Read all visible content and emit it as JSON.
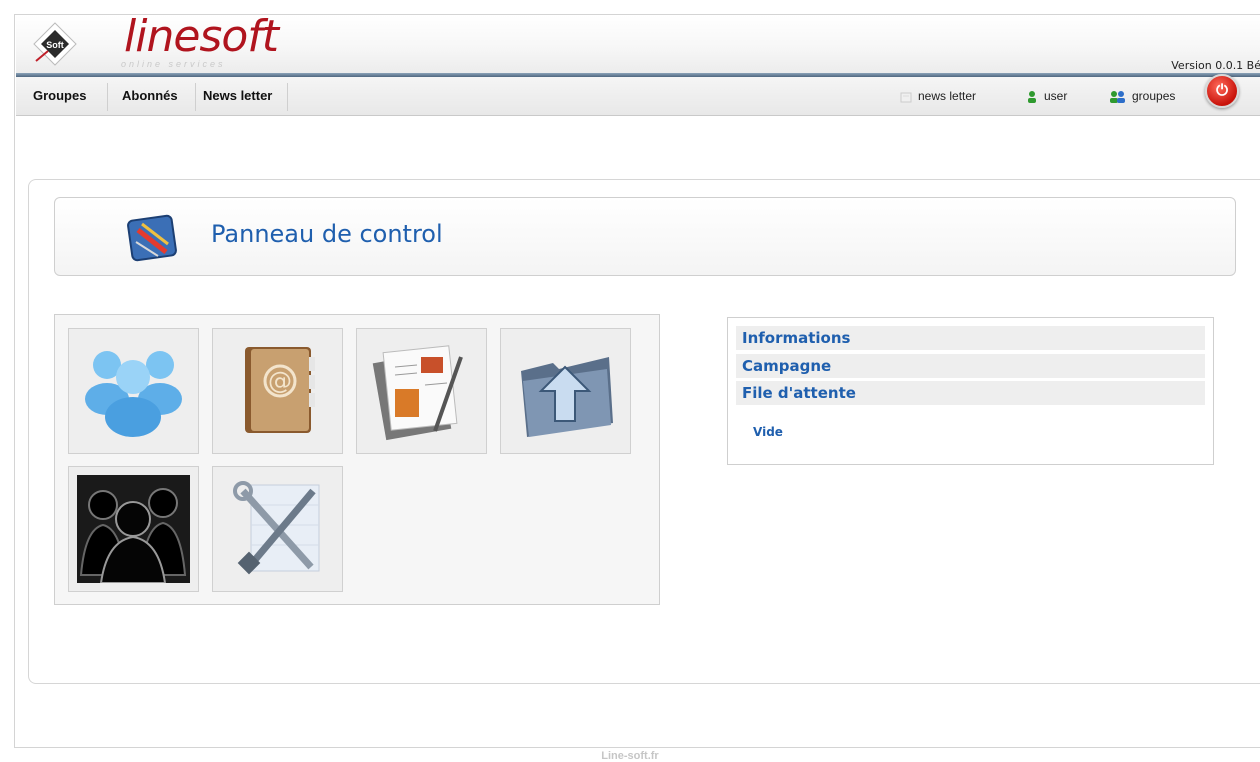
{
  "header": {
    "brand": "linesoft",
    "brand_sub": "online services",
    "logo_text": "Soft",
    "version": "Version 0.0.1 Bé"
  },
  "menu": {
    "items": [
      {
        "label": "Groupes"
      },
      {
        "label": "Abonnés"
      },
      {
        "label": "News letter"
      }
    ]
  },
  "quick_links": [
    {
      "label": "news letter",
      "icon": "newsletter-icon"
    },
    {
      "label": "user",
      "icon": "user-icon"
    },
    {
      "label": "groupes",
      "icon": "groups-icon"
    }
  ],
  "panel": {
    "title": "Panneau de control"
  },
  "tiles": [
    {
      "icon": "groups-blue-icon"
    },
    {
      "icon": "address-book-icon"
    },
    {
      "icon": "document-edit-icon"
    },
    {
      "icon": "folder-upload-icon"
    },
    {
      "icon": "subscribers-silhouette-icon"
    },
    {
      "icon": "tools-icon"
    }
  ],
  "info": {
    "rows": [
      "Informations",
      "Campagne",
      "File d'attente"
    ],
    "queue_status": "Vide"
  },
  "footer": {
    "text": "Line-soft.fr"
  },
  "colors": {
    "brand": "#b0141e",
    "accent": "#1f5fae",
    "power": "#c8120a"
  }
}
